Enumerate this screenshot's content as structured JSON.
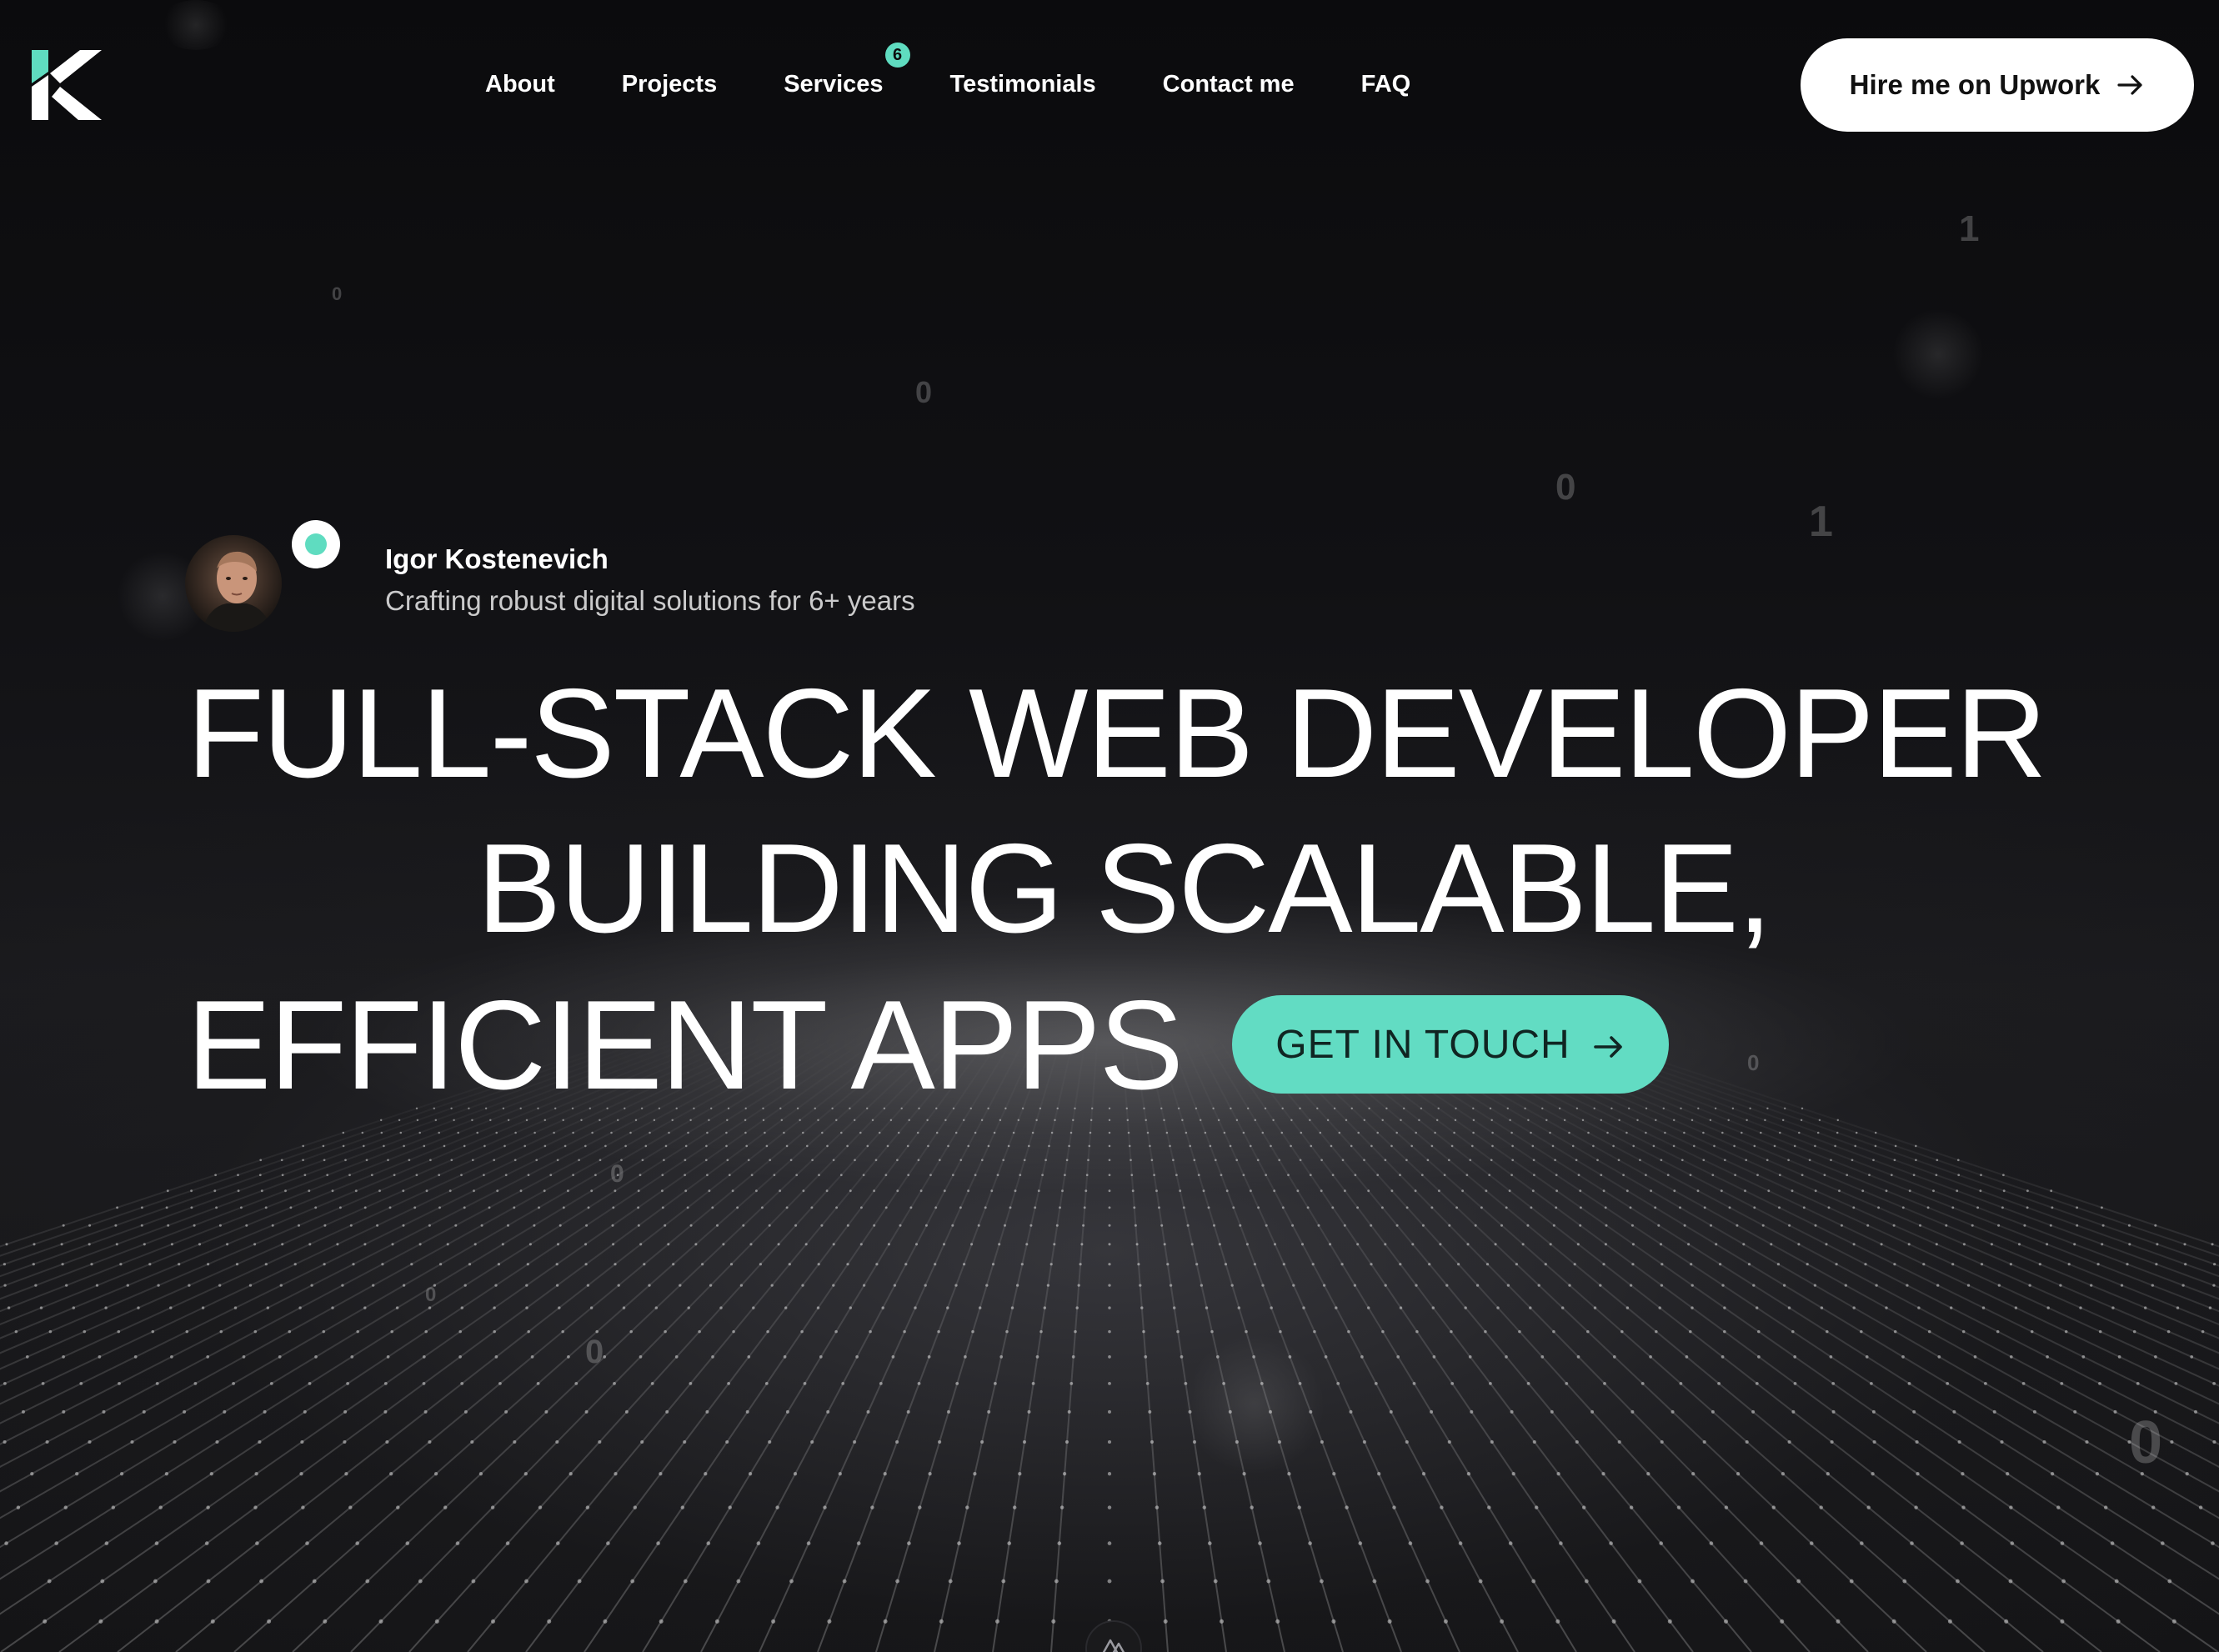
{
  "header": {
    "logo_alt": "K",
    "nav": [
      {
        "label": "About"
      },
      {
        "label": "Projects"
      },
      {
        "label": "Services",
        "badge": "6"
      },
      {
        "label": "Testimonials"
      },
      {
        "label": "Contact me"
      },
      {
        "label": "FAQ"
      }
    ],
    "hire_button": {
      "label": "Hire me on Upwork",
      "icon": "arrow-right-icon"
    }
  },
  "profile": {
    "name": "Igor Kostenevich",
    "tagline": "Crafting robust digital solutions for 6+ years",
    "status": "online"
  },
  "hero": {
    "headline_lines": [
      "FULL-STACK WEB DEVELOPER",
      "BUILDING SCALABLE,",
      "EFFICIENT APPS"
    ],
    "cta": {
      "label": "GET IN TOUCH",
      "icon": "arrow-right-icon"
    }
  },
  "background_digits": [
    "1",
    "0",
    "0",
    "1",
    "0",
    "0",
    "0",
    "0",
    "0",
    "0"
  ],
  "colors": {
    "accent": "#62dcc3",
    "background": "#0c0c0e",
    "text": "#ffffff",
    "button_light": "#ffffff"
  }
}
